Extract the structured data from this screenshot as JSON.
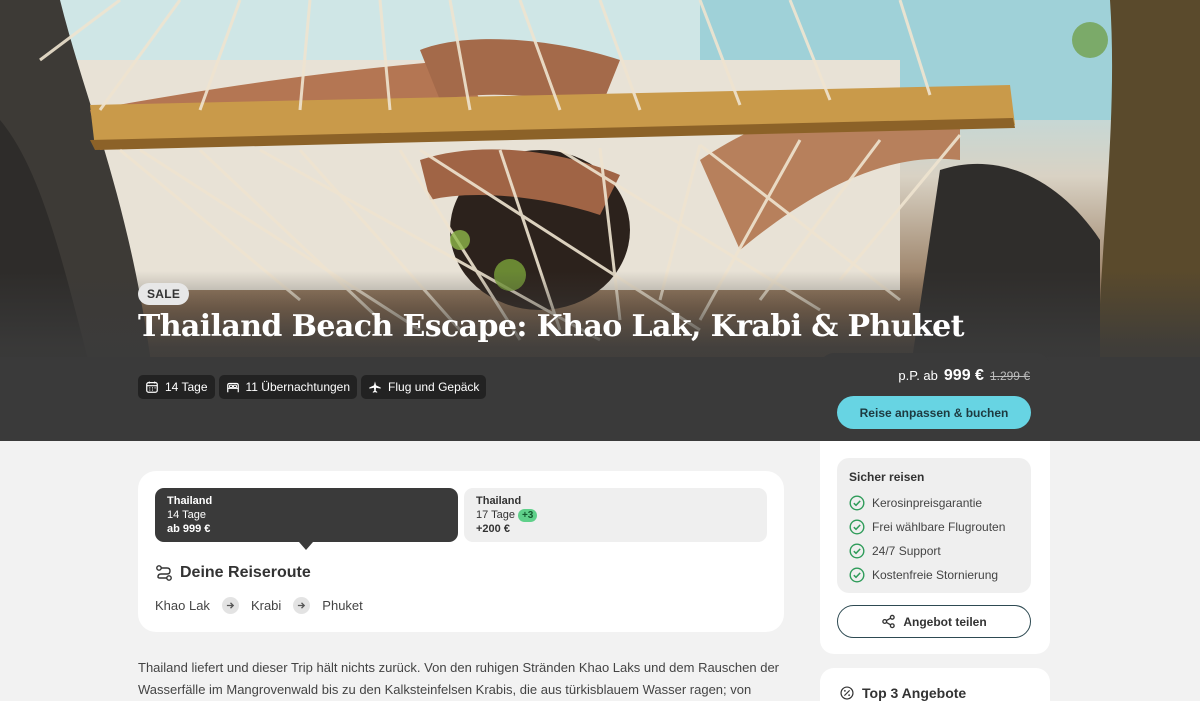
{
  "hero": {
    "sale_badge": "SALE",
    "title": "Thailand Beach Escape: Khao Lak, Krabi & Phuket",
    "chips": [
      {
        "icon": "calendar-icon",
        "label": "14 Tage"
      },
      {
        "icon": "bed-icon",
        "label": "11 Übernachtungen"
      },
      {
        "icon": "plane-icon",
        "label": "Flug und Gepäck"
      }
    ]
  },
  "route_card": {
    "options": [
      {
        "title": "Thailand",
        "days": "14 Tage",
        "price": "ab 999 €",
        "active": true
      },
      {
        "title": "Thailand",
        "days": "17 Tage",
        "extra_badge": "+3",
        "price": "+200 €",
        "active": false
      }
    ],
    "heading": "Deine Reiseroute",
    "stops": [
      "Khao Lak",
      "Krabi",
      "Phuket"
    ]
  },
  "description": "Thailand liefert und dieser Trip hält nichts zurück. Von den ruhigen Stränden Khao Laks und dem Rauschen der Wasserfälle im Mangrovenwald bis zu den Kalksteinfelsen Krabis, die aus türkisblauem Wasser ragen; von",
  "sidebar": {
    "price_prefix": "p.P. ab",
    "price_now": "999 €",
    "price_old": "1.299 €",
    "book_button": "Reise anpassen & buchen",
    "safe_title": "Sicher reisen",
    "safe_items": [
      "Kerosinpreisgarantie",
      "Frei wählbare Flugrouten",
      "24/7 Support",
      "Kostenfreie Stornierung"
    ],
    "share_button": "Angebot teilen",
    "top3_title": "Top 3 Angebote"
  },
  "colors": {
    "accent": "#67d4e3",
    "dark": "#3a3a3a",
    "check_green": "#2f9c5a",
    "badge_green": "#5fd08a"
  }
}
